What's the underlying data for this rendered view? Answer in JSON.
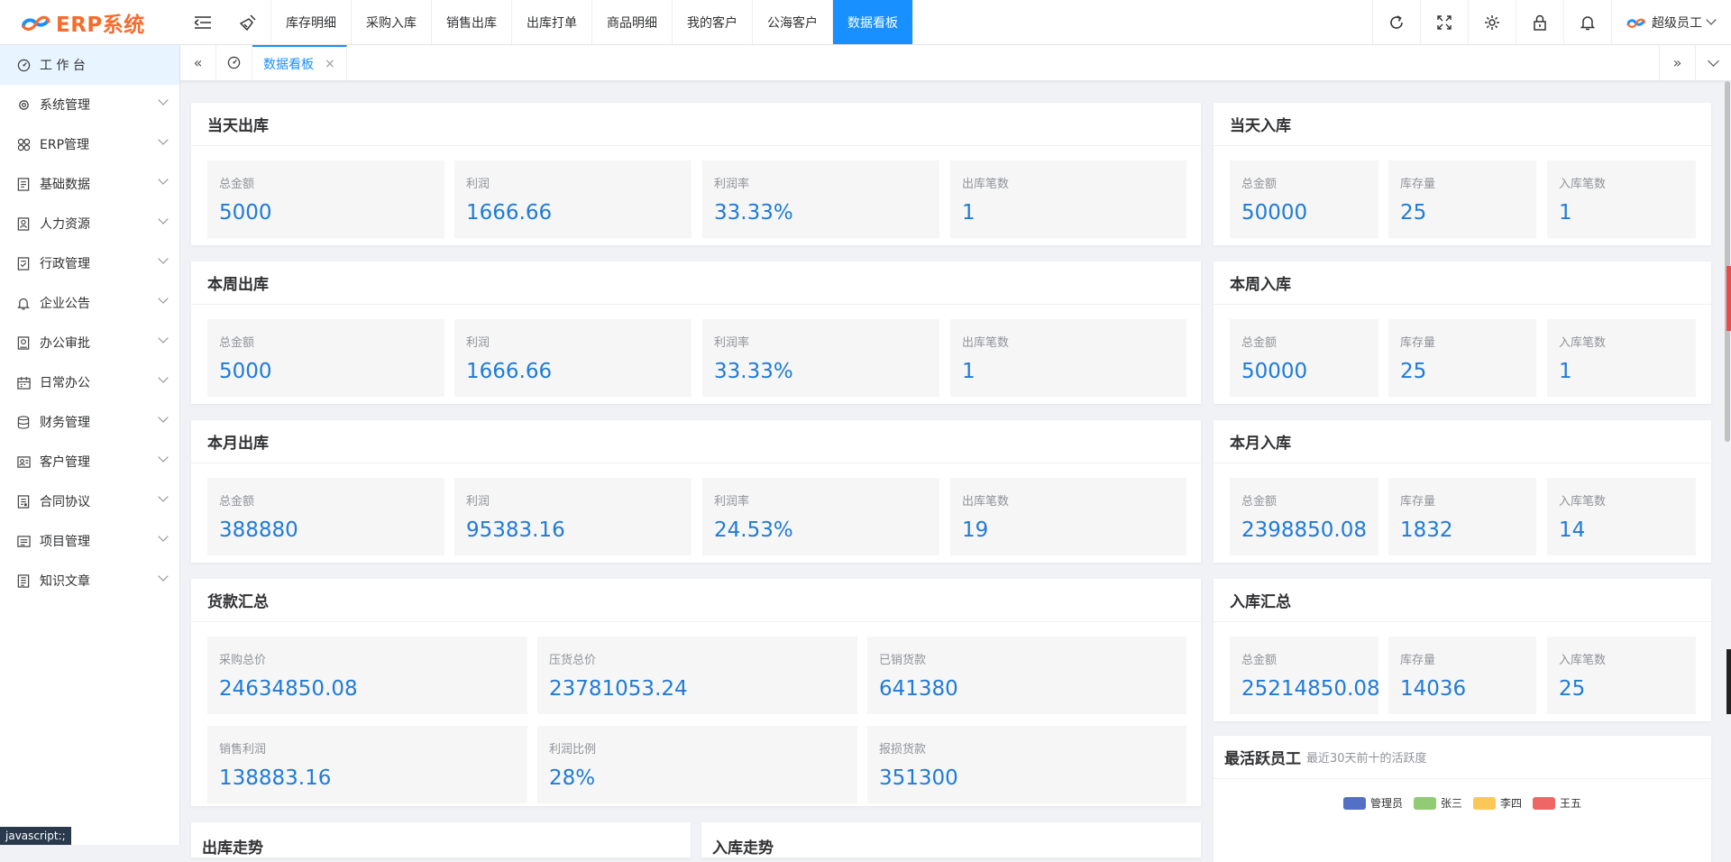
{
  "app": {
    "logo_text": "ERP系统",
    "brand_color": "#f56c2d",
    "accent": "#1890ff"
  },
  "topbar": {
    "menu_icon": "menu-fold-icon",
    "brush_icon": "clear-brush-icon",
    "tabs": [
      {
        "label": "库存明细",
        "active": false
      },
      {
        "label": "采购入库",
        "active": false
      },
      {
        "label": "销售出库",
        "active": false
      },
      {
        "label": "出库打单",
        "active": false
      },
      {
        "label": "商品明细",
        "active": false
      },
      {
        "label": "我的客户",
        "active": false
      },
      {
        "label": "公海客户",
        "active": false
      },
      {
        "label": "数据看板",
        "active": true
      }
    ],
    "right_icons": [
      "refresh-icon",
      "fullscreen-icon",
      "gear-icon",
      "lock-icon",
      "bell-icon"
    ],
    "user_name": "超级员工"
  },
  "sidebar": {
    "items": [
      {
        "label": "工 作 台",
        "icon": "dashboard-icon",
        "expandable": false
      },
      {
        "label": "系统管理",
        "icon": "system-icon",
        "expandable": true
      },
      {
        "label": "ERP管理",
        "icon": "erp-icon",
        "expandable": true
      },
      {
        "label": "基础数据",
        "icon": "data-icon",
        "expandable": true
      },
      {
        "label": "人力资源",
        "icon": "person-icon",
        "expandable": true
      },
      {
        "label": "行政管理",
        "icon": "admin-icon",
        "expandable": true
      },
      {
        "label": "企业公告",
        "icon": "bell-icon",
        "expandable": true
      },
      {
        "label": "办公审批",
        "icon": "approval-icon",
        "expandable": true
      },
      {
        "label": "日常办公",
        "icon": "calendar-icon",
        "expandable": true
      },
      {
        "label": "财务管理",
        "icon": "finance-icon",
        "expandable": true
      },
      {
        "label": "客户管理",
        "icon": "customer-icon",
        "expandable": true
      },
      {
        "label": "合同协议",
        "icon": "contract-icon",
        "expandable": true
      },
      {
        "label": "项目管理",
        "icon": "project-icon",
        "expandable": true
      },
      {
        "label": "知识文章",
        "icon": "article-icon",
        "expandable": true
      }
    ]
  },
  "tabbar": {
    "active_tab": "数据看板",
    "close": "×"
  },
  "dashboard": {
    "today_out": {
      "title": "当天出库",
      "stats": [
        {
          "label": "总金额",
          "value": "5000"
        },
        {
          "label": "利润",
          "value": "1666.66"
        },
        {
          "label": "利润率",
          "value": "33.33%"
        },
        {
          "label": "出库笔数",
          "value": "1"
        }
      ]
    },
    "today_in": {
      "title": "当天入库",
      "stats": [
        {
          "label": "总金额",
          "value": "50000"
        },
        {
          "label": "库存量",
          "value": "25"
        },
        {
          "label": "入库笔数",
          "value": "1"
        }
      ]
    },
    "week_out": {
      "title": "本周出库",
      "stats": [
        {
          "label": "总金额",
          "value": "5000"
        },
        {
          "label": "利润",
          "value": "1666.66"
        },
        {
          "label": "利润率",
          "value": "33.33%"
        },
        {
          "label": "出库笔数",
          "value": "1"
        }
      ]
    },
    "week_in": {
      "title": "本周入库",
      "stats": [
        {
          "label": "总金额",
          "value": "50000"
        },
        {
          "label": "库存量",
          "value": "25"
        },
        {
          "label": "入库笔数",
          "value": "1"
        }
      ]
    },
    "month_out": {
      "title": "本月出库",
      "stats": [
        {
          "label": "总金额",
          "value": "388880"
        },
        {
          "label": "利润",
          "value": "95383.16"
        },
        {
          "label": "利润率",
          "value": "24.53%"
        },
        {
          "label": "出库笔数",
          "value": "19"
        }
      ]
    },
    "month_in": {
      "title": "本月入库",
      "stats": [
        {
          "label": "总金额",
          "value": "2398850.08"
        },
        {
          "label": "库存量",
          "value": "1832"
        },
        {
          "label": "入库笔数",
          "value": "14"
        }
      ]
    },
    "payment": {
      "title": "货款汇总",
      "stats": [
        {
          "label": "采购总价",
          "value": "24634850.08"
        },
        {
          "label": "压货总价",
          "value": "23781053.24"
        },
        {
          "label": "已销货款",
          "value": "641380"
        },
        {
          "label": "销售利润",
          "value": "138883.16"
        },
        {
          "label": "利润比例",
          "value": "28%"
        },
        {
          "label": "报损货款",
          "value": "351300"
        }
      ]
    },
    "in_summary": {
      "title": "入库汇总",
      "stats": [
        {
          "label": "总金额",
          "value": "25214850.08"
        },
        {
          "label": "库存量",
          "value": "14036"
        },
        {
          "label": "入库笔数",
          "value": "25"
        }
      ]
    },
    "active_staff": {
      "title": "最活跃员工",
      "subtitle": "最近30天前十的活跃度",
      "legend": [
        {
          "name": "管理员",
          "color": "#5470c6"
        },
        {
          "name": "张三",
          "color": "#91cc75"
        },
        {
          "name": "李四",
          "color": "#fac858"
        },
        {
          "name": "王五",
          "color": "#ee6666"
        }
      ]
    },
    "out_trend": {
      "title": "出库走势"
    },
    "in_trend": {
      "title": "入库走势"
    }
  },
  "status_tip": "javascript:;"
}
